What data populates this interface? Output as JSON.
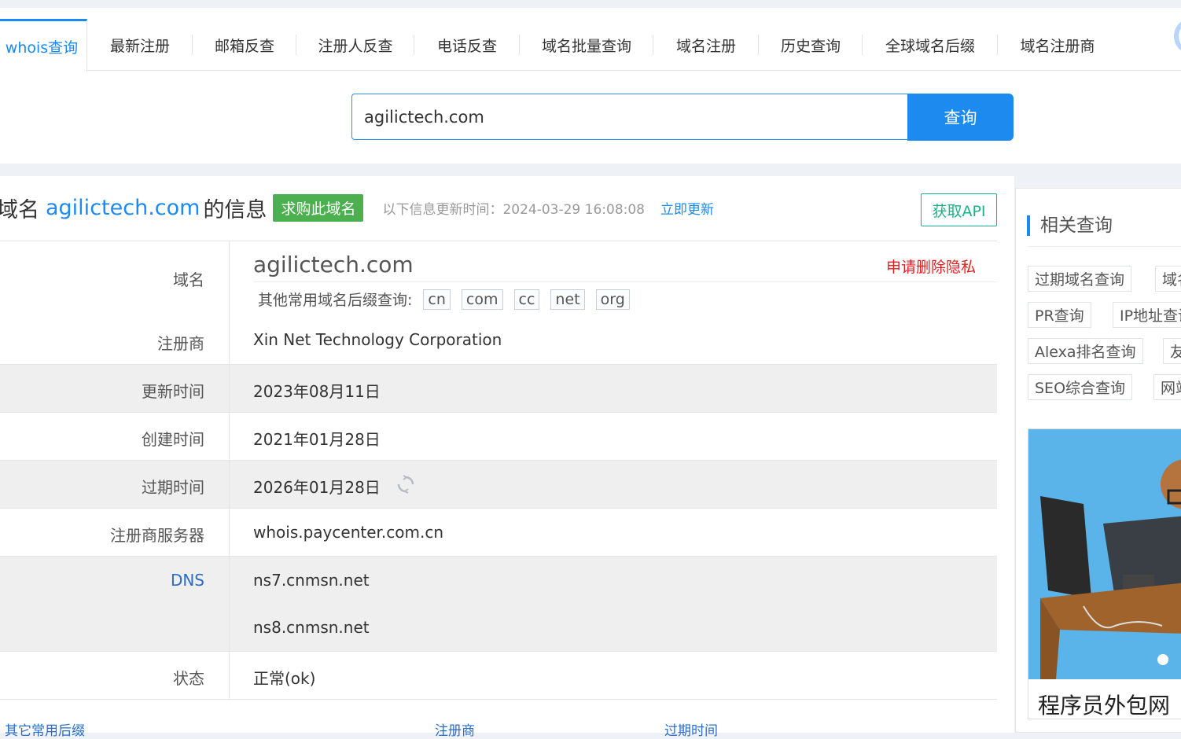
{
  "tabs": [
    {
      "label": "whois查询",
      "active": true
    },
    {
      "label": "最新注册"
    },
    {
      "label": "邮箱反查"
    },
    {
      "label": "注册人反查"
    },
    {
      "label": "电话反查"
    },
    {
      "label": "域名批量查询"
    },
    {
      "label": "域名注册"
    },
    {
      "label": "历史查询"
    },
    {
      "label": "全球域名后缀"
    },
    {
      "label": "域名注册商"
    }
  ],
  "search": {
    "value": "agilictech.com",
    "button_label": "查询"
  },
  "header": {
    "prefix": "域名",
    "domain": "agilictech.com",
    "suffix": "的信息",
    "buy_label": "求购此域名",
    "update_label": "以下信息更新时间：2024-03-29 16:08:08",
    "update_link": "立即更新",
    "api_label": "获取API"
  },
  "info": {
    "domain_label": "域名",
    "domain_value": "agilictech.com",
    "privacy_link": "申请删除隐私",
    "suffix_prompt": "其他常用域名后缀查询:",
    "suffixes": [
      "cn",
      "com",
      "cc",
      "net",
      "org"
    ],
    "registrar_label": "注册商",
    "registrar_value": "Xin Net Technology Corporation",
    "updated_label": "更新时间",
    "updated_value": "2023年08月11日",
    "created_label": "创建时间",
    "created_value": "2021年01月28日",
    "expire_label": "过期时间",
    "expire_value": "2026年01月28日",
    "server_label": "注册商服务器",
    "server_value": "whois.paycenter.com.cn",
    "dns_label": "DNS",
    "dns_values": [
      "ns7.cnmsn.net",
      "ns8.cnmsn.net"
    ],
    "status_label": "状态",
    "status_value": "正常(ok)"
  },
  "bottom_hints": [
    "其它常用后缀",
    "注册商",
    "过期时间"
  ],
  "sidebar": {
    "title": "相关查询",
    "tags": [
      "过期域名查询",
      "域名",
      "PR查询",
      "IP地址查询",
      "Alexa排名查询",
      "友",
      "SEO综合查询",
      "网站"
    ],
    "ad_caption": "程序员外包网"
  },
  "colors": {
    "accent": "#1d8af0",
    "buy": "#4caf50",
    "api": "#19b28a",
    "privacy": "#e02020"
  }
}
